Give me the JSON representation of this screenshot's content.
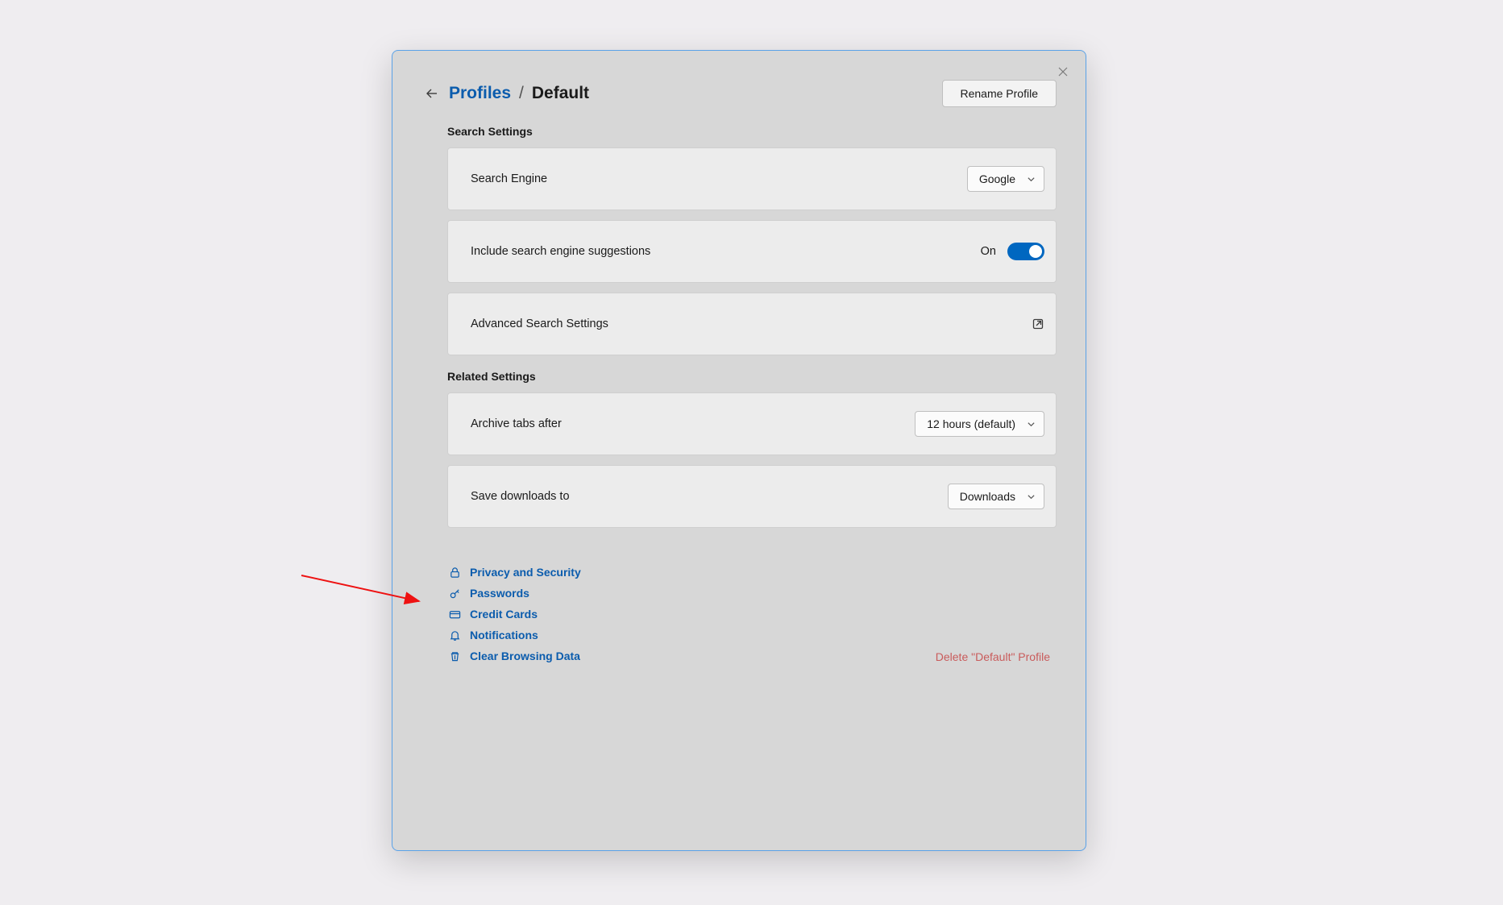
{
  "header": {
    "breadcrumb_root": "Profiles",
    "breadcrumb_sep": "/",
    "breadcrumb_current": "Default",
    "rename_label": "Rename Profile"
  },
  "sections": {
    "search_settings_title": "Search Settings",
    "search_engine_label": "Search Engine",
    "search_engine_value": "Google",
    "suggestions_label": "Include search engine suggestions",
    "suggestions_value": "On",
    "advanced_label": "Advanced Search Settings",
    "related_title": "Related Settings",
    "archive_label": "Archive tabs after",
    "archive_value": "12 hours (default)",
    "downloads_label": "Save downloads to",
    "downloads_value": "Downloads"
  },
  "links": {
    "privacy": "Privacy and Security",
    "passwords": "Passwords",
    "credit": "Credit Cards",
    "notifications": "Notifications",
    "clear": "Clear Browsing Data",
    "delete_profile": "Delete \"Default\" Profile"
  }
}
